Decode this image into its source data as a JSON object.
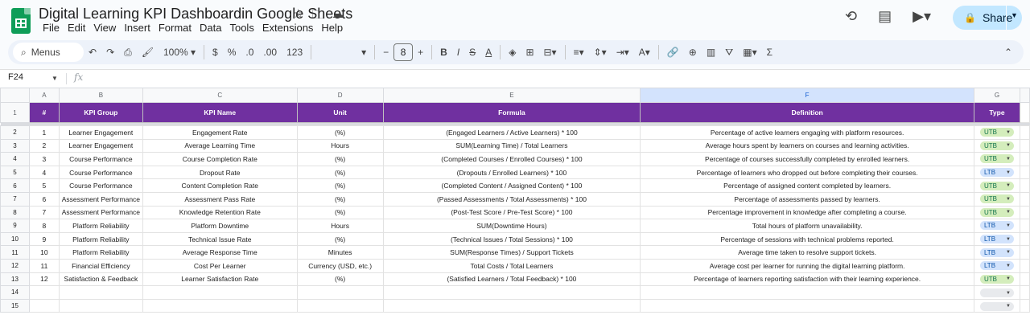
{
  "app": {
    "doc_title": "Digital Learning KPI Dashboardin Google Sheets",
    "menu": [
      "File",
      "Edit",
      "View",
      "Insert",
      "Format",
      "Data",
      "Tools",
      "Extensions",
      "Help"
    ],
    "share_label": "Share"
  },
  "toolbar": {
    "search_label": "Menus",
    "zoom": "100%",
    "currency": "$",
    "percent": "%",
    "dec_less": ".0",
    "dec_more": ".00",
    "number_format": "123",
    "font_size": "8"
  },
  "formula_bar": {
    "cell_ref": "F24",
    "fx": "fx"
  },
  "columns": [
    "A",
    "B",
    "C",
    "D",
    "E",
    "F",
    "G"
  ],
  "header": [
    "#",
    "KPI Group",
    "KPI Name",
    "Unit",
    "Formula",
    "Definition",
    "Type"
  ],
  "rows": [
    {
      "num": "1",
      "group": "Learner Engagement",
      "name": "Engagement Rate",
      "unit": "(%)",
      "formula": "(Engaged Learners / Active Learners) * 100",
      "definition": "Percentage of active learners engaging with platform resources.",
      "type": "UTB"
    },
    {
      "num": "2",
      "group": "Learner Engagement",
      "name": "Average Learning Time",
      "unit": "Hours",
      "formula": "SUM(Learning Time) / Total Learners",
      "definition": "Average hours spent by learners on courses and learning activities.",
      "type": "UTB"
    },
    {
      "num": "3",
      "group": "Course Performance",
      "name": "Course Completion Rate",
      "unit": "(%)",
      "formula": "(Completed Courses / Enrolled Courses) * 100",
      "definition": "Percentage of courses successfully completed by enrolled learners.",
      "type": "UTB"
    },
    {
      "num": "4",
      "group": "Course Performance",
      "name": "Dropout Rate",
      "unit": "(%)",
      "formula": "(Dropouts / Enrolled Learners) * 100",
      "definition": "Percentage of learners who dropped out before completing their courses.",
      "type": "LTB"
    },
    {
      "num": "5",
      "group": "Course Performance",
      "name": "Content Completion Rate",
      "unit": "(%)",
      "formula": "(Completed Content / Assigned Content) * 100",
      "definition": "Percentage of assigned content completed by learners.",
      "type": "UTB"
    },
    {
      "num": "6",
      "group": "Assessment Performance",
      "name": "Assessment Pass Rate",
      "unit": "(%)",
      "formula": "(Passed Assessments / Total Assessments) * 100",
      "definition": "Percentage of assessments passed by learners.",
      "type": "UTB"
    },
    {
      "num": "7",
      "group": "Assessment Performance",
      "name": "Knowledge Retention Rate",
      "unit": "(%)",
      "formula": "(Post-Test Score / Pre-Test Score) * 100",
      "definition": "Percentage improvement in knowledge after completing a course.",
      "type": "UTB"
    },
    {
      "num": "8",
      "group": "Platform Reliability",
      "name": "Platform Downtime",
      "unit": "Hours",
      "formula": "SUM(Downtime Hours)",
      "definition": "Total hours of platform unavailability.",
      "type": "LTB"
    },
    {
      "num": "9",
      "group": "Platform Reliability",
      "name": "Technical Issue Rate",
      "unit": "(%)",
      "formula": "(Technical Issues / Total Sessions) * 100",
      "definition": "Percentage of sessions with technical problems reported.",
      "type": "LTB"
    },
    {
      "num": "10",
      "group": "Platform Reliability",
      "name": "Average Response Time",
      "unit": "Minutes",
      "formula": "SUM(Response Times) / Support Tickets",
      "definition": "Average time taken to resolve support tickets.",
      "type": "LTB"
    },
    {
      "num": "11",
      "group": "Financial Efficiency",
      "name": "Cost Per Learner",
      "unit": "Currency (USD, etc.)",
      "formula": "Total Costs / Total Learners",
      "definition": "Average cost per learner for running the digital learning platform.",
      "type": "LTB"
    },
    {
      "num": "12",
      "group": "Satisfaction & Feedback",
      "name": "Learner Satisfaction Rate",
      "unit": "(%)",
      "formula": "(Satisfied Learners / Total Feedback) * 100",
      "definition": "Percentage of learners reporting satisfaction with their learning experience.",
      "type": "UTB"
    }
  ],
  "row_numbers": [
    "1",
    "2",
    "3",
    "4",
    "5",
    "6",
    "7",
    "8",
    "9",
    "10",
    "11",
    "12",
    "13",
    "14",
    "15"
  ],
  "colors": {
    "header_bg": "#7030a0",
    "utb_chip": "#d4edbc",
    "ltb_chip": "#d2e3fc",
    "share_bg": "#c2e7ff"
  }
}
